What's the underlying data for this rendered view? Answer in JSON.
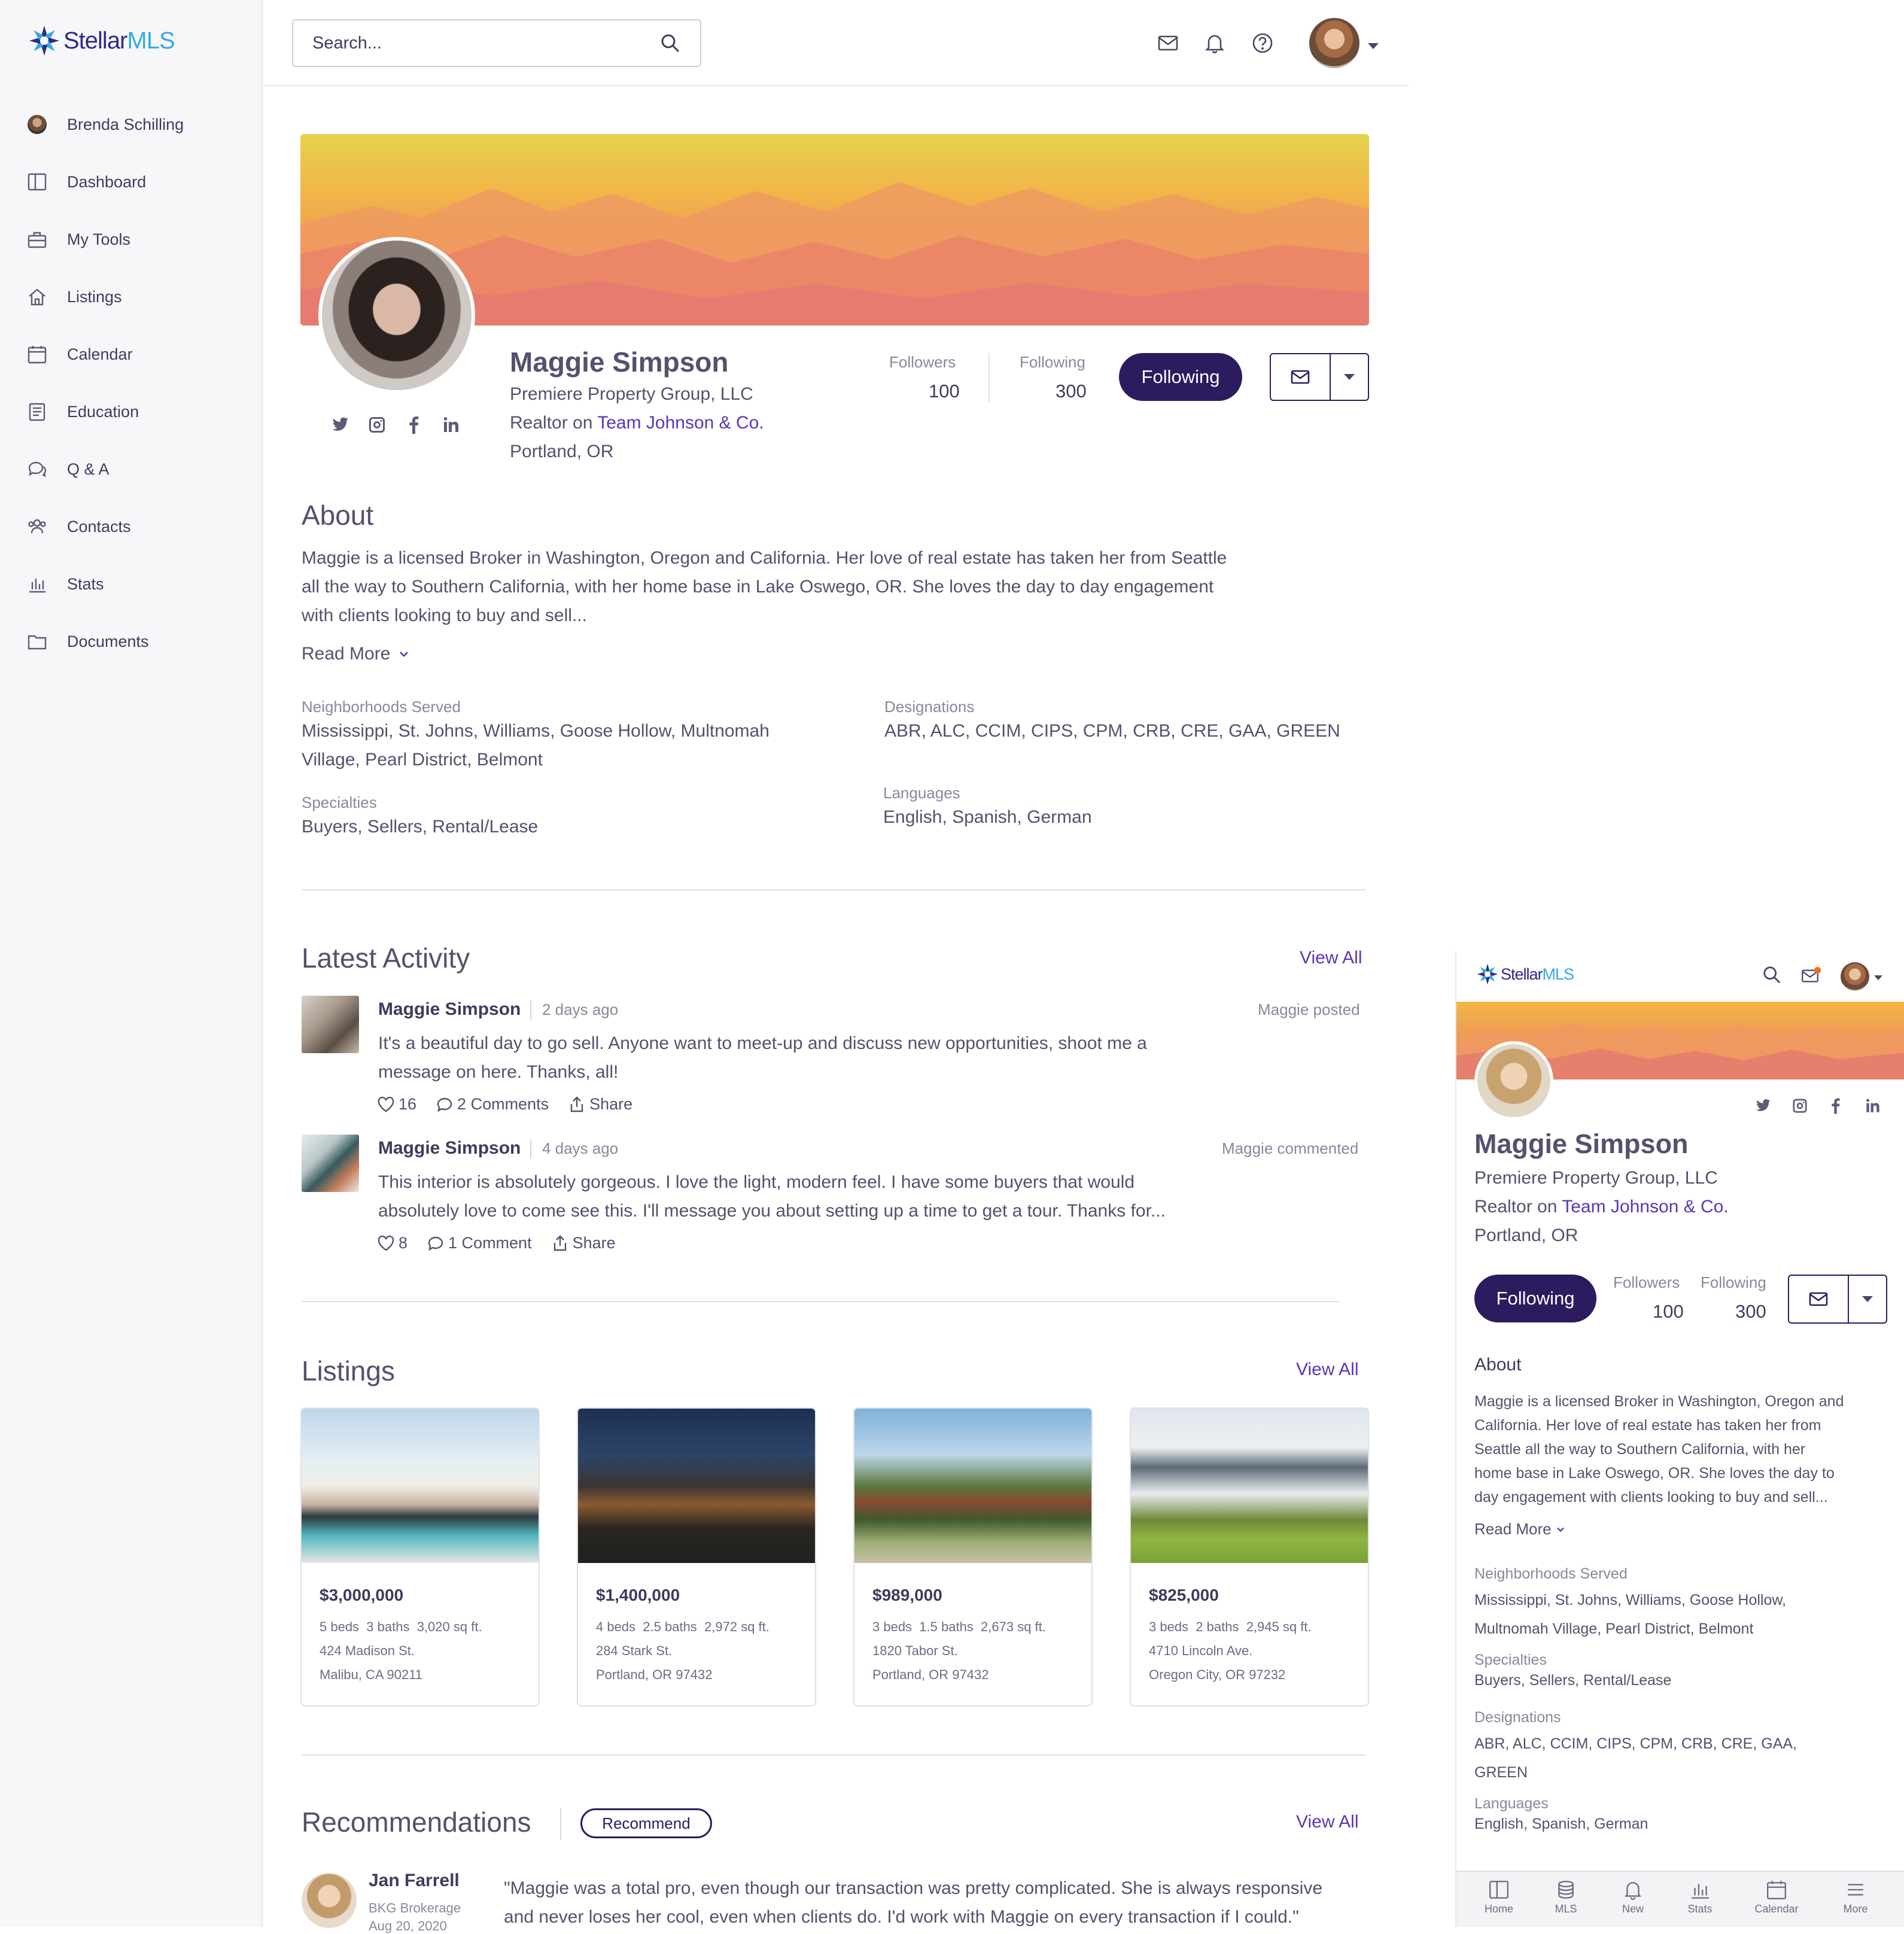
{
  "brand": {
    "name_part1": "Stellar",
    "name_part2": "MLS",
    "colors": {
      "primary": "#2c1b5e",
      "link": "#5b35b8",
      "accent": "#36a9e1"
    }
  },
  "sidebar": {
    "items": [
      {
        "label": "Brenda Schilling",
        "icon": "user-avatar"
      },
      {
        "label": "Dashboard",
        "icon": "dashboard-icon"
      },
      {
        "label": "My Tools",
        "icon": "toolbox-icon"
      },
      {
        "label": "Listings",
        "icon": "home-icon"
      },
      {
        "label": "Calendar",
        "icon": "calendar-icon"
      },
      {
        "label": "Education",
        "icon": "education-icon"
      },
      {
        "label": "Q & A",
        "icon": "chat-icon"
      },
      {
        "label": "Contacts",
        "icon": "contacts-icon"
      },
      {
        "label": "Stats",
        "icon": "stats-icon"
      },
      {
        "label": "Documents",
        "icon": "folder-icon"
      }
    ]
  },
  "header": {
    "search_placeholder": "Search..."
  },
  "profile": {
    "name": "Maggie Simpson",
    "company": "Premiere Property Group, LLC",
    "role_prefix": "Realtor on ",
    "team": "Team Johnson & Co.",
    "location": "Portland, OR",
    "followers_label": "Followers",
    "followers": "100",
    "following_label": "Following",
    "following": "300",
    "following_button": "Following"
  },
  "about": {
    "title": "About",
    "lines": [
      "Maggie is a licensed Broker in Washington, Oregon and California. Her love of real estate has taken her from Seattle",
      "all the way to Southern California, with her home base in Lake Oswego, OR. She loves the day to day engagement",
      "with clients looking to buy and sell..."
    ],
    "read_more": "Read More",
    "neighborhoods_label": "Neighborhoods Served",
    "neighborhoods_l1": "Mississippi, St. Johns, Williams, Goose Hollow, Multnomah",
    "neighborhoods_l2": "Village, Pearl District, Belmont",
    "designations_label": "Designations",
    "designations": "ABR, ALC, CCIM, CIPS, CPM, CRB, CRE, GAA, GREEN",
    "specialties_label": "Specialties",
    "specialties": "Buyers, Sellers, Rental/Lease",
    "languages_label": "Languages",
    "languages": "English, Spanish, German"
  },
  "activity": {
    "title": "Latest Activity",
    "view_all": "View All",
    "items": [
      {
        "name": "Maggie Simpson",
        "time": "2 days ago",
        "meta": "Maggie posted",
        "line1": "It's a beautiful day to go sell. Anyone want to meet-up and discuss new opportunities, shoot me a",
        "line2": "message on here. Thanks, all!",
        "likes": "16",
        "comments": "2 Comments",
        "share": "Share"
      },
      {
        "name": "Maggie Simpson",
        "time": "4 days ago",
        "meta": "Maggie commented",
        "line1": "This interior is absolutely gorgeous. I love the light, modern feel. I have some buyers that would",
        "line2": "absolutely love to come see this. I'll message you about setting up a time to get a tour. Thanks for...",
        "likes": "8",
        "comments": "1 Comment",
        "share": "Share"
      }
    ]
  },
  "listings": {
    "title": "Listings",
    "view_all": "View All",
    "items": [
      {
        "price": "$3,000,000",
        "beds": "5 beds",
        "baths": "3 baths",
        "sqft": "3,020 sq ft.",
        "street": "424 Madison St.",
        "city": "Malibu, CA 90211"
      },
      {
        "price": "$1,400,000",
        "beds": "4 beds",
        "baths": "2.5 baths",
        "sqft": "2,972 sq ft.",
        "street": "284 Stark St.",
        "city": "Portland, OR 97432"
      },
      {
        "price": "$989,000",
        "beds": "3 beds",
        "baths": "1.5 baths",
        "sqft": "2,673 sq ft.",
        "street": "1820 Tabor St.",
        "city": "Portland, OR 97432"
      },
      {
        "price": "$825,000",
        "beds": "3 beds",
        "baths": "2 baths",
        "sqft": "2,945 sq ft.",
        "street": "4710 Lincoln Ave.",
        "city": "Oregon City, OR 97232"
      }
    ]
  },
  "recommendations": {
    "title": "Recommendations",
    "recommend_button": "Recommend",
    "view_all": "View All",
    "item": {
      "name": "Jan Farrell",
      "company": "BKG Brokerage",
      "date": "Aug 20, 2020",
      "line1": "\"Maggie was a total pro, even though our transaction was pretty complicated. She is always responsive",
      "line2": "and never loses her cool, even when clients do. I'd work with Maggie on every transaction if I could.\""
    }
  },
  "mobile": {
    "about_lines": [
      "Maggie is a licensed Broker in Washington, Oregon and",
      "California. Her love of real estate has taken her from",
      "Seattle all the way to Southern California, with her",
      "home base in Lake Oswego, OR. She loves the day to",
      "day engagement with clients looking to buy and sell..."
    ],
    "neighborhoods_l1": "Mississippi, St. Johns, Williams, Goose Hollow,",
    "neighborhoods_l2": "Multnomah Village, Pearl District, Belmont",
    "designations_l1": "ABR, ALC, CCIM, CIPS, CPM, CRB, CRE, GAA,",
    "designations_l2": "GREEN",
    "tabs": [
      "Home",
      "MLS",
      "New",
      "Stats",
      "Calendar",
      "More"
    ]
  }
}
